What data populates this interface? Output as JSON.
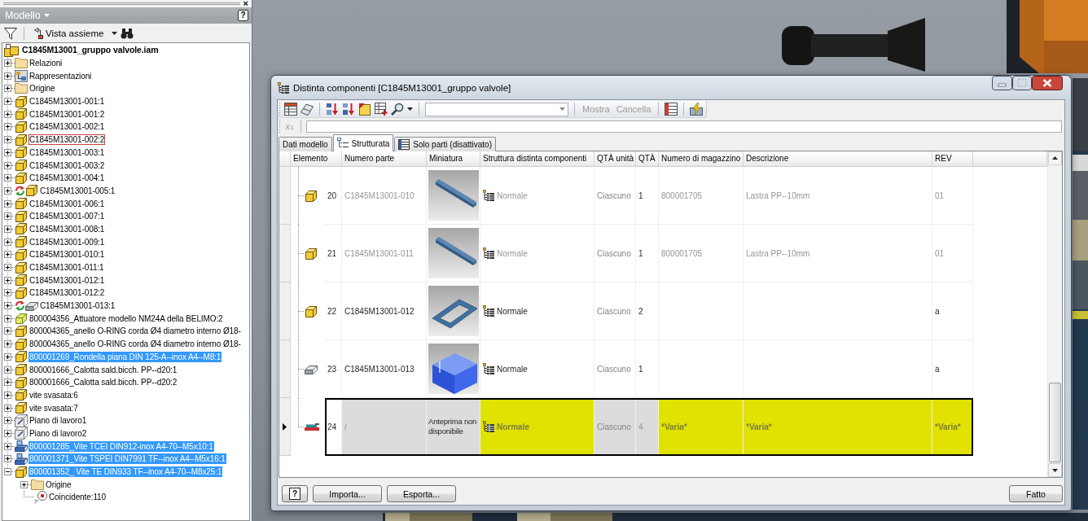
{
  "model_browser": {
    "close": "×",
    "title": "Modello",
    "help": "?",
    "view_button": "Vista assieme",
    "tree": {
      "label": "C1845M13001_gruppo valvole.iam",
      "kind": "assembly",
      "children": [
        {
          "label": "Relazioni",
          "kind": "folder",
          "expandable": true,
          "expanded": false,
          "selected": false,
          "hover": false
        },
        {
          "label": "Rappresentazioni",
          "kind": "views",
          "expandable": true,
          "expanded": false,
          "selected": false,
          "hover": false
        },
        {
          "label": "Origine",
          "kind": "folder",
          "expandable": true,
          "expanded": false,
          "selected": false,
          "hover": false
        },
        {
          "label": "C1845M13001-001:1",
          "kind": "part",
          "expandable": true,
          "expanded": false,
          "selected": false,
          "hover": false
        },
        {
          "label": "C1845M13001-001:2",
          "kind": "part",
          "expandable": true,
          "expanded": false,
          "selected": false,
          "hover": false
        },
        {
          "label": "C1845M13001-002:1",
          "kind": "part",
          "expandable": true,
          "expanded": false,
          "selected": false,
          "hover": false
        },
        {
          "label": "C1845M13001-002:2",
          "kind": "part",
          "expandable": true,
          "expanded": false,
          "selected": false,
          "hover": true
        },
        {
          "label": "C1845M13001-003:1",
          "kind": "part",
          "expandable": true,
          "expanded": false,
          "selected": false,
          "hover": false
        },
        {
          "label": "C1845M13001-003:2",
          "kind": "part",
          "expandable": true,
          "expanded": false,
          "selected": false,
          "hover": false
        },
        {
          "label": "C1845M13001-004:1",
          "kind": "part",
          "expandable": true,
          "expanded": false,
          "selected": false,
          "hover": false
        },
        {
          "label": "C1845M13001-005:1",
          "kind": "adaptive-part",
          "expandable": true,
          "expanded": false,
          "selected": false,
          "hover": false
        },
        {
          "label": "C1845M13001-006:1",
          "kind": "part",
          "expandable": true,
          "expanded": false,
          "selected": false,
          "hover": false
        },
        {
          "label": "C1845M13001-007:1",
          "kind": "part",
          "expandable": true,
          "expanded": false,
          "selected": false,
          "hover": false
        },
        {
          "label": "C1845M13001-008:1",
          "kind": "part",
          "expandable": true,
          "expanded": false,
          "selected": false,
          "hover": false
        },
        {
          "label": "C1845M13001-009:1",
          "kind": "part",
          "expandable": true,
          "expanded": false,
          "selected": false,
          "hover": false
        },
        {
          "label": "C1845M13001-010:1",
          "kind": "part",
          "expandable": true,
          "expanded": false,
          "selected": false,
          "hover": false
        },
        {
          "label": "C1845M13001-011:1",
          "kind": "part",
          "expandable": true,
          "expanded": false,
          "selected": false,
          "hover": false
        },
        {
          "label": "C1845M13001-012:1",
          "kind": "part",
          "expandable": true,
          "expanded": false,
          "selected": false,
          "hover": false
        },
        {
          "label": "C1845M13001-012:2",
          "kind": "part",
          "expandable": true,
          "expanded": false,
          "selected": false,
          "hover": false
        },
        {
          "label": "C1845M13001-013:1",
          "kind": "adaptive-sheet",
          "expandable": true,
          "expanded": false,
          "selected": false,
          "hover": false
        },
        {
          "label": "800004356_Attuatore modello NM24A della BELIMO:2",
          "kind": "derived",
          "expandable": true,
          "expanded": false,
          "selected": false,
          "hover": false
        },
        {
          "label": "800004365_anello O-RING corda Ø4 diametro interno Ø18-",
          "kind": "part",
          "expandable": true,
          "expanded": false,
          "selected": false,
          "hover": false
        },
        {
          "label": "800004365_anello O-RING corda Ø4 diametro interno Ø18-",
          "kind": "part",
          "expandable": true,
          "expanded": false,
          "selected": false,
          "hover": false
        },
        {
          "label": "800001269_Rondella piana DIN 125-A--inox A4--M8:1",
          "kind": "part",
          "expandable": true,
          "expanded": false,
          "selected": true,
          "hover": false
        },
        {
          "label": "800001666_Calotta sald.bicch. PP--d20:1",
          "kind": "part",
          "expandable": true,
          "expanded": false,
          "selected": false,
          "hover": false
        },
        {
          "label": "800001666_Calotta sald.bicch. PP--d20:2",
          "kind": "part",
          "expandable": true,
          "expanded": false,
          "selected": false,
          "hover": false
        },
        {
          "label": "vite svasata:6",
          "kind": "part",
          "expandable": true,
          "expanded": false,
          "selected": false,
          "hover": false
        },
        {
          "label": "vite svasata:7",
          "kind": "part",
          "expandable": true,
          "expanded": false,
          "selected": false,
          "hover": false
        },
        {
          "label": "Piano di lavoro1",
          "kind": "workplane",
          "expandable": true,
          "expanded": false,
          "selected": false,
          "hover": false
        },
        {
          "label": "Piano di lavoro2",
          "kind": "workplane",
          "expandable": true,
          "expanded": false,
          "selected": false,
          "hover": false
        },
        {
          "label": "800001285_Vite TCEI DIN912-inox A4-70--M5x10:1",
          "kind": "fastener",
          "expandable": true,
          "expanded": false,
          "selected": true,
          "hover": false
        },
        {
          "label": "800001371_Vite TSPEI DIN7991 TF--inox A4--M5x16:1",
          "kind": "fastener",
          "expandable": true,
          "expanded": false,
          "selected": true,
          "hover": false
        },
        {
          "label": "800001352_ Vite TE DIN933 TF--inox A4-70--M8x25:1",
          "kind": "part",
          "expandable": true,
          "expanded": true,
          "selected": true,
          "hover": false,
          "children": [
            {
              "label": "Origine",
              "kind": "folder",
              "expandable": true,
              "expanded": false,
              "selected": false,
              "hover": false
            },
            {
              "label": "Coincidente:110",
              "kind": "constraint",
              "expandable": false,
              "expanded": false,
              "selected": false,
              "hover": false
            }
          ]
        }
      ]
    }
  },
  "dialog": {
    "title": "Distinta componenti [C1845M13001_gruppo valvole]",
    "toolbar": {
      "buttons": [
        {
          "label": "Mostra",
          "disabled": true
        },
        {
          "label": "Cancella",
          "disabled": true
        }
      ]
    },
    "formula_bar": {
      "icon": "x₁",
      "disabled": true
    },
    "tabs": [
      {
        "label": "Dati modello",
        "kind": "model",
        "selected": false
      },
      {
        "label": "Strutturata",
        "kind": "structured",
        "selected": true
      },
      {
        "label": "Solo parti (disattivato)",
        "kind": "parts",
        "selected": false
      }
    ],
    "table": {
      "columns": [
        {
          "label": "Elemento",
          "kind": "item",
          "muted": false
        },
        {
          "label": "Numero parte",
          "kind": "readonly",
          "muted": false
        },
        {
          "label": "Miniatura",
          "kind": "readonly",
          "muted": false
        },
        {
          "label": "Struttura distinta componenti",
          "kind": "editable",
          "muted": false
        },
        {
          "label": "QTÀ unità",
          "kind": "readonly",
          "muted": true
        },
        {
          "label": "QTÀ",
          "kind": "readonly",
          "muted": false
        },
        {
          "label": "Numero di magazzino",
          "kind": "editable",
          "muted": false
        },
        {
          "label": "Descrizione",
          "kind": "editable",
          "muted": false
        },
        {
          "label": "REV",
          "kind": "editable",
          "muted": false
        }
      ],
      "rows": [
        {
          "kind": "part",
          "item": "20",
          "part_number": "C1845M13001-010",
          "thumbnail": {
            "kind": "bar"
          },
          "structure": "Normale",
          "unit_qty": "Ciascuno",
          "qty": "1",
          "stock_number": "800001705",
          "description": "Lastra PP--10mm",
          "rev": "01",
          "dimmed": true,
          "highlighted": false,
          "selected": false
        },
        {
          "kind": "part",
          "item": "21",
          "part_number": "C1845M13001-011",
          "thumbnail": {
            "kind": "bar"
          },
          "structure": "Normale",
          "unit_qty": "Ciascuno",
          "qty": "1",
          "stock_number": "800001705",
          "description": "Lastra PP--10mm",
          "rev": "01",
          "dimmed": true,
          "highlighted": false,
          "selected": false
        },
        {
          "kind": "part",
          "item": "22",
          "part_number": "C1845M13001-012",
          "thumbnail": {
            "kind": "frame"
          },
          "structure": "Normale",
          "unit_qty": "Ciascuno",
          "qty": "2",
          "rev": "a",
          "dimmed": false,
          "highlighted": false,
          "selected": false
        },
        {
          "kind": "sheet",
          "item": "23",
          "part_number": "C1845M13001-013",
          "thumbnail": {
            "kind": "box"
          },
          "structure": "Normale",
          "unit_qty": "Ciascuno",
          "qty": "1",
          "rev": "a",
          "dimmed": false,
          "highlighted": false,
          "selected": false
        },
        {
          "kind": "stack",
          "item": "24",
          "part_number": "/",
          "thumbnail": {
            "kind": "text",
            "text": "Anteprima non disponibile"
          },
          "structure": "Normale",
          "unit_qty": "Ciascuno",
          "qty": "4",
          "stock_number": "*Varia*",
          "description": "*Varia*",
          "rev": "*Varia*",
          "dimmed": true,
          "highlighted": true,
          "selected": true
        }
      ]
    },
    "help": "?",
    "buttons": [
      "Importa...",
      "Esporta..."
    ],
    "done": "Fatto"
  }
}
